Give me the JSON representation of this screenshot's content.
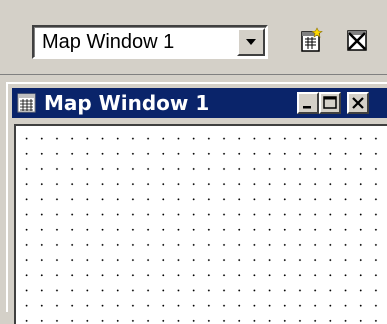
{
  "toolbar": {
    "window_select_value": "Map Window 1",
    "icons": [
      "new-map-window-icon",
      "close-map-window-icon"
    ]
  },
  "map_window": {
    "title": "Map Window 1",
    "icon": "map-window-icon",
    "title_bar_color": "#0a246a",
    "caption_buttons": [
      "minimize-icon",
      "maximize-icon",
      "close-icon"
    ]
  }
}
